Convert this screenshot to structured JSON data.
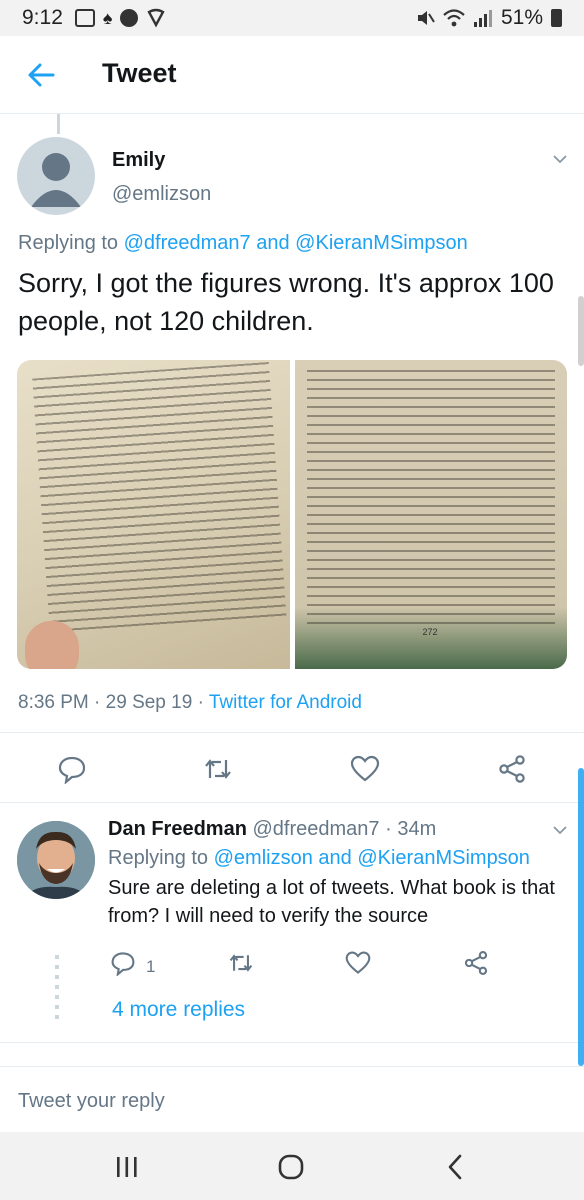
{
  "status_bar": {
    "time": "9:12",
    "battery": "51%",
    "icons": [
      "app-notification-icon",
      "accessibility-icon",
      "chat-bubble-icon",
      "vpn-shield-icon",
      "mute-icon",
      "wifi-icon",
      "signal-icon",
      "battery-icon"
    ]
  },
  "header": {
    "title": "Tweet"
  },
  "tweet": {
    "name": "Emily",
    "handle": "@emlizson",
    "replying_prefix": "Replying to",
    "replying_to_1": "@dfreedman7",
    "replying_and": "and",
    "replying_to_2": "@KieranMSimpson",
    "text": "Sorry, I got the figures wrong. It's approx 100 people, not 120 children.",
    "time": "8:36 PM",
    "date": "29 Sep 19",
    "source": "Twitter for Android",
    "meta_sep": "·",
    "photo_right_page": "272"
  },
  "reply": {
    "name": "Dan Freedman",
    "handle": "@dfreedman7",
    "age": "· 34m",
    "replying_prefix": "Replying to",
    "replying_to_1": "@emlizson",
    "replying_and": "and",
    "replying_to_2": "@KieranMSimpson",
    "text": "Sure are deleting a lot of tweets. What book is that from? I will need to verify the source",
    "reply_count": "1",
    "more_replies": "4 more replies"
  },
  "compose": {
    "placeholder": "Tweet your reply"
  },
  "colors": {
    "accent": "#1da1f2",
    "text": "#14171a",
    "muted": "#657786",
    "divider": "#e6ecf0"
  }
}
